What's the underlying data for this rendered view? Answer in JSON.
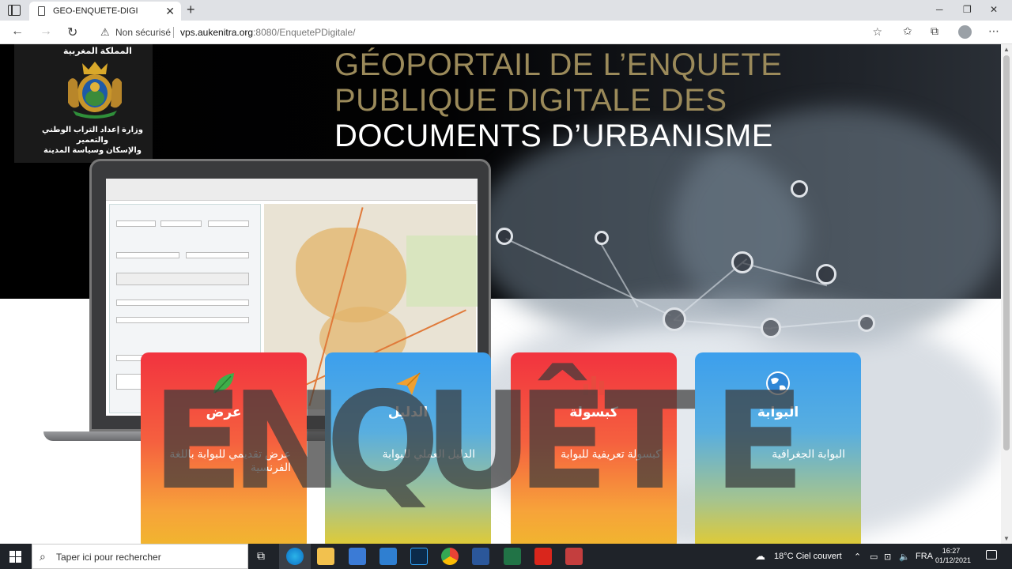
{
  "browser": {
    "tab_title": "GEO-ENQUETE-DIGI",
    "close_glyph": "✕",
    "newtab_glyph": "+",
    "security_label": "Non sécurisé",
    "url_host": "vps.aukenitra.org",
    "url_rest": ":8080/EnquetePDigitale/",
    "icons": [
      "sidebar-toggle-icon",
      "page-icon",
      "back-icon",
      "forward-icon",
      "refresh-icon",
      "warning-icon",
      "favorite-add-icon",
      "favorites-icon",
      "collections-icon",
      "profile-icon",
      "more-icon"
    ]
  },
  "header": {
    "kingdom": "المملكة المغربية",
    "ministry_line1": "وزارة إعداد التراب الوطني والتعمير",
    "ministry_line2": "والإسكان وسياسة المدينة",
    "title_line1": "GÉOPORTAIL DE L’ENQUETE",
    "title_line2": "PUBLIQUE DIGITALE DES",
    "title_line3": "DOCUMENTS D’URBANISME"
  },
  "cards": [
    {
      "title": "عرض",
      "text": "عرض تقديمي للبوابة باللغة الفرنسية",
      "icon": "leaf-icon"
    },
    {
      "title": "الدليل",
      "text": "الدليل العملي للبوابة",
      "icon": "paper-plane-icon"
    },
    {
      "title": "كبسولة",
      "text": "كبسولة تعريفية للبوابة",
      "icon": "chart-icon"
    },
    {
      "title": "البوابة",
      "text": "البوابة الجغرافية",
      "icon": "globe-icon"
    }
  ],
  "watermark": {
    "l1": "E",
    "l2": "N",
    "l3": "Q",
    "l4": "U",
    "l5": "Ê",
    "l6": "T",
    "l7": "E"
  },
  "taskbar": {
    "search_placeholder": "Taper ici pour rechercher",
    "weather": "18°C  Ciel couvert",
    "language": "FRA",
    "time": "16:27",
    "date": "01/12/2021"
  },
  "colors": {
    "gold": "#9b8a5a",
    "card_red": "#f2333f",
    "card_blue": "#3c9fed",
    "card_yellow": "#e6cb2c"
  }
}
